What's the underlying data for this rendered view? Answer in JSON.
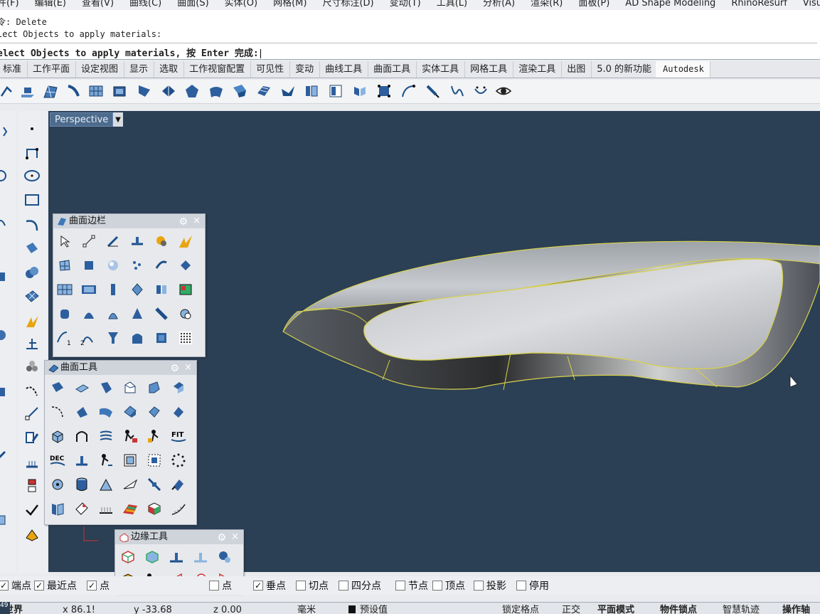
{
  "menubar": [
    "件(F)",
    "编辑(E)",
    "查看(V)",
    "曲线(C)",
    "曲面(S)",
    "实体(O)",
    "网格(M)",
    "尺寸标注(D)",
    "变动(T)",
    "工具(L)",
    "分析(A)",
    "渲染(R)",
    "面板(P)",
    "AD Shape Modeling",
    "RhinoResurf",
    "VisualARQ"
  ],
  "command": {
    "history1": "令: Delete",
    "history2": "lect Objects to apply materials:",
    "prompt": "elect Objects to apply materials, 按 Enter 完成:"
  },
  "tabs": [
    "标准",
    "工作平面",
    "设定视图",
    "显示",
    "选取",
    "工作视窗配置",
    "可见性",
    "变动",
    "曲线工具",
    "曲面工具",
    "实体工具",
    "网格工具",
    "渲染工具",
    "出图",
    "5.0 的新功能",
    "Autodesk"
  ],
  "active_tab": "Autodesk",
  "viewport": {
    "label": "Perspective",
    "dropdown": "▼"
  },
  "panels": {
    "surface_sidebar": {
      "title": "曲面边栏",
      "gear": "⚙",
      "close": "×"
    },
    "surface_tools": {
      "title": "曲面工具",
      "gear": "⚙",
      "close": "×"
    },
    "edge_tools": {
      "title": "边缘工具",
      "gear": "⚙",
      "close": "×"
    }
  },
  "icon_labels": {
    "dec": "DEC",
    "fit": "FIT",
    "one": "1",
    "two": "2"
  },
  "snaps": [
    {
      "label": "端点",
      "checked": true
    },
    {
      "label": "最近点",
      "checked": true
    },
    {
      "label": "点",
      "checked": true
    },
    {
      "label": "点",
      "checked": false
    },
    {
      "label": "垂点",
      "checked": true
    },
    {
      "label": "切点",
      "checked": false
    },
    {
      "label": "四分点",
      "checked": false
    },
    {
      "label": "节点",
      "checked": false
    },
    {
      "label": "顶点",
      "checked": false
    },
    {
      "label": "投影",
      "checked": false
    },
    {
      "label": "停用",
      "checked": false
    }
  ],
  "status": {
    "left_mark": "49",
    "world": "世界",
    "x": "x 86.1!",
    "y": "y -33.68",
    "z": "z 0.00",
    "unit": "毫米",
    "layer": "预设值",
    "lock_grid": "锁定格点",
    "ortho": "正交",
    "planar": "平面模式",
    "osnap": "物件锁点",
    "smarttrack": "智慧轨迹",
    "gumball": "操作轴"
  },
  "colors": {
    "viewport_bg": "#2b3f55",
    "edge_yellow": "#d8d24a",
    "title_blue": "#4d6b8c"
  }
}
